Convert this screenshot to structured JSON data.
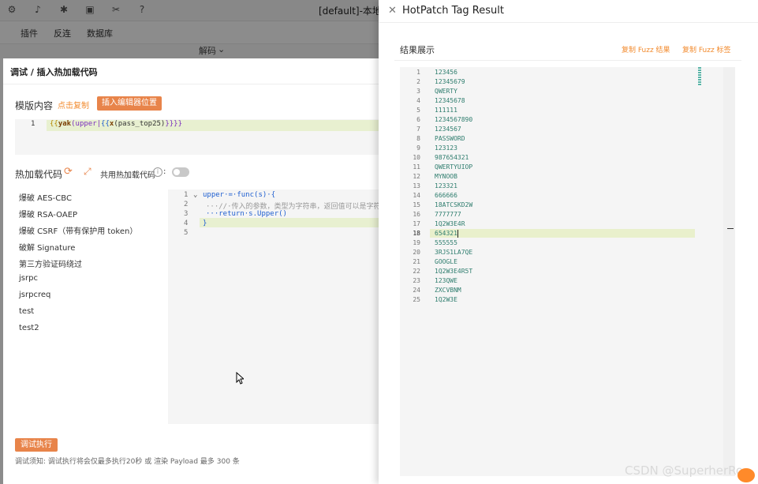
{
  "window": {
    "title": "[default]-本地模",
    "top_icons": [
      "gear-icon",
      "bell-icon",
      "bug-icon",
      "terminal-icon",
      "tools-icon",
      "help-icon"
    ]
  },
  "menubar": {
    "items": [
      "插件",
      "反连",
      "数据库"
    ]
  },
  "subbar": {
    "decode": "解码"
  },
  "debug_panel": {
    "title": "调试 / 插入热加载代码",
    "template_label": "模版内容",
    "copy_link": "点击复制",
    "insert_button": "插入编辑器位置",
    "template_line_number": "1",
    "template_code": {
      "open": "{{",
      "fn": "yak",
      "a": "(upper|",
      "b": "{{",
      "c": "x",
      "d": "(pass_top25)",
      "close": "}}}}"
    },
    "hotload_label": "热加载代码",
    "share_label": "共用热加载代码",
    "colon": ":",
    "templates": [
      "爆破 AES-CBC",
      "爆破 RSA-OAEP",
      "爆破 CSRF（带有保护用 token）",
      "破解 Signature",
      "第三方验证码绕过",
      "jsrpc",
      "jsrpcreq",
      "test",
      "test2"
    ],
    "code_lines": [
      {
        "num": "1",
        "text": "upper·=·func(s)·{"
      },
      {
        "num": "2",
        "text": "···//·传入的参数，类型为字符串，返回值可以是字符"
      },
      {
        "num": "3",
        "text": "···return·s.Upper()"
      },
      {
        "num": "4",
        "text": "}"
      },
      {
        "num": "5",
        "text": ""
      }
    ],
    "run_button": "调试执行",
    "tip": "调试须知: 调试执行将会仅最多执行20秒 或 渲染 Payload 最多 300 条"
  },
  "drawer": {
    "title": "HotPatch Tag Result",
    "result_title": "结果展示",
    "copy_result": "复制 Fuzz 结果",
    "copy_tag": "复制 Fuzz 标签",
    "current_line": 18,
    "lines": [
      "123456",
      "12345679",
      "QWERTY",
      "12345678",
      "111111",
      "1234567890",
      "1234567",
      "PASSWORD",
      "123123",
      "987654321",
      "QWERTYUIOP",
      "MYNOOB",
      "123321",
      "666666",
      "18ATCSKD2W",
      "7777777",
      "1Q2W3E4R",
      "654321",
      "555555",
      "3RJS1LA7QE",
      "GOOGLE",
      "1Q2W3E4R5T",
      "123QWE",
      "ZXCVBNM",
      "1Q2W3E"
    ]
  },
  "watermark": "CSDN @SuperherRo",
  "colors": {
    "accent": "#e8844a",
    "link": "#f28b2f",
    "result_text": "#2e7d6e"
  }
}
